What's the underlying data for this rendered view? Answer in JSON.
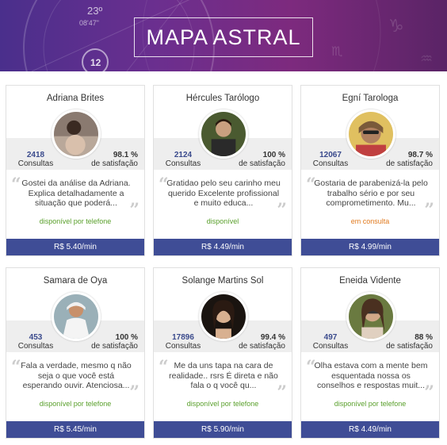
{
  "banner": {
    "title": "MAPA ASTRAL",
    "decor_text": [
      "23º",
      "08'47\"",
      "12"
    ]
  },
  "colors": {
    "banner_start": "#4a2f8c",
    "banner_end": "#7d2a7e",
    "price_bar": "#3f4d96",
    "consultas_number": "#3a4a8c",
    "available": "#5aa02c",
    "busy": "#e07a1f"
  },
  "stats_labels": {
    "consultas": "Consultas",
    "satisfacao": "de satisfação"
  },
  "cards": [
    {
      "name": "Adriana Brites",
      "consultas": "2418",
      "satisfacao": "98.1 %",
      "comment": "Gostei da análise da Adriana. Explica detalhadamente a situação que poderá...",
      "availability": "disponível por telefone",
      "status": "available",
      "price": "R$ 5.40/min"
    },
    {
      "name": "Hércules Tarólogo",
      "consultas": "2124",
      "satisfacao": "100 %",
      "comment": "Gratidao pelo seu carinho meu querido Excelente profissional e muito educa...",
      "availability": "disponível",
      "status": "available",
      "price": "R$ 4.49/min"
    },
    {
      "name": "Egní Tarologa",
      "consultas": "12067",
      "satisfacao": "98.7 %",
      "comment": "Gostaria de parabenizá-la pelo trabalho sério e por seu comprometimento. Mu...",
      "availability": "em consulta",
      "status": "busy",
      "price": "R$ 4.99/min"
    },
    {
      "name": "Samara de Oya",
      "consultas": "453",
      "satisfacao": "100 %",
      "comment": "Fala a verdade, mesmo q não seja o que você está esperando ouvir. Atenciosa...",
      "availability": "disponível por telefone",
      "status": "available",
      "price": "R$ 5.45/min"
    },
    {
      "name": "Solange Martins Sol",
      "consultas": "17896",
      "satisfacao": "99.4 %",
      "comment": "Me da uns tapa na cara de realidade.. rsrs É direta e não fala o q você qu...",
      "availability": "disponível por telefone",
      "status": "available",
      "price": "R$ 5.90/min"
    },
    {
      "name": "Eneida Vidente",
      "consultas": "497",
      "satisfacao": "88 %",
      "comment": "Olha estava com a mente bem esquentada nossa os conselhos e respostas muit...",
      "availability": "disponível por telefone",
      "status": "available",
      "price": "R$ 4.49/min"
    }
  ]
}
